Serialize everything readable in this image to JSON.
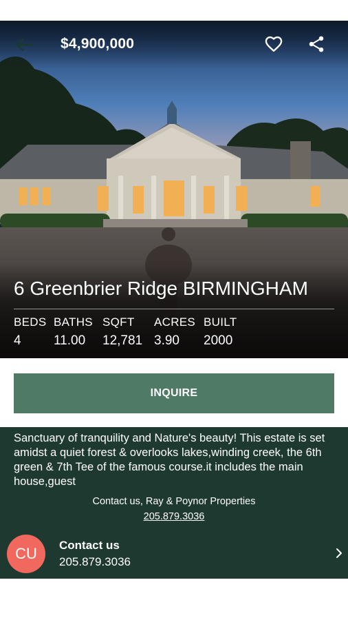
{
  "header": {
    "price": "$4,900,000",
    "back_icon": "back-arrow-icon",
    "favorite_icon": "heart-icon",
    "share_icon": "share-icon"
  },
  "listing": {
    "address": "6 Greenbrier Ridge BIRMINGHAM",
    "stats": [
      {
        "label": "BEDS",
        "value": "4"
      },
      {
        "label": "BATHS",
        "value": "11.00"
      },
      {
        "label": "SQFT",
        "value": "12,781"
      },
      {
        "label": "ACRES",
        "value": "3.90"
      },
      {
        "label": "BUILT",
        "value": "2000"
      }
    ]
  },
  "actions": {
    "inquire_label": "INQUIRE"
  },
  "description": {
    "text": "Sanctuary of tranquility and Nature's beauty! This estate is set amidst a quiet forest & overlooks lakes,winding creek, the 6th green & 7th Tee of the famous course.it includes the main house,guest",
    "contact_line": "Contact us, Ray & Poynor Properties",
    "contact_phone": "205.879.3036"
  },
  "agent": {
    "initials": "CU",
    "title": "Contact us",
    "phone": "205.879.3036"
  },
  "colors": {
    "inquire_bg": "#4f7a66",
    "description_bg": "#1e3a30",
    "avatar_bg": "#f1695e"
  }
}
